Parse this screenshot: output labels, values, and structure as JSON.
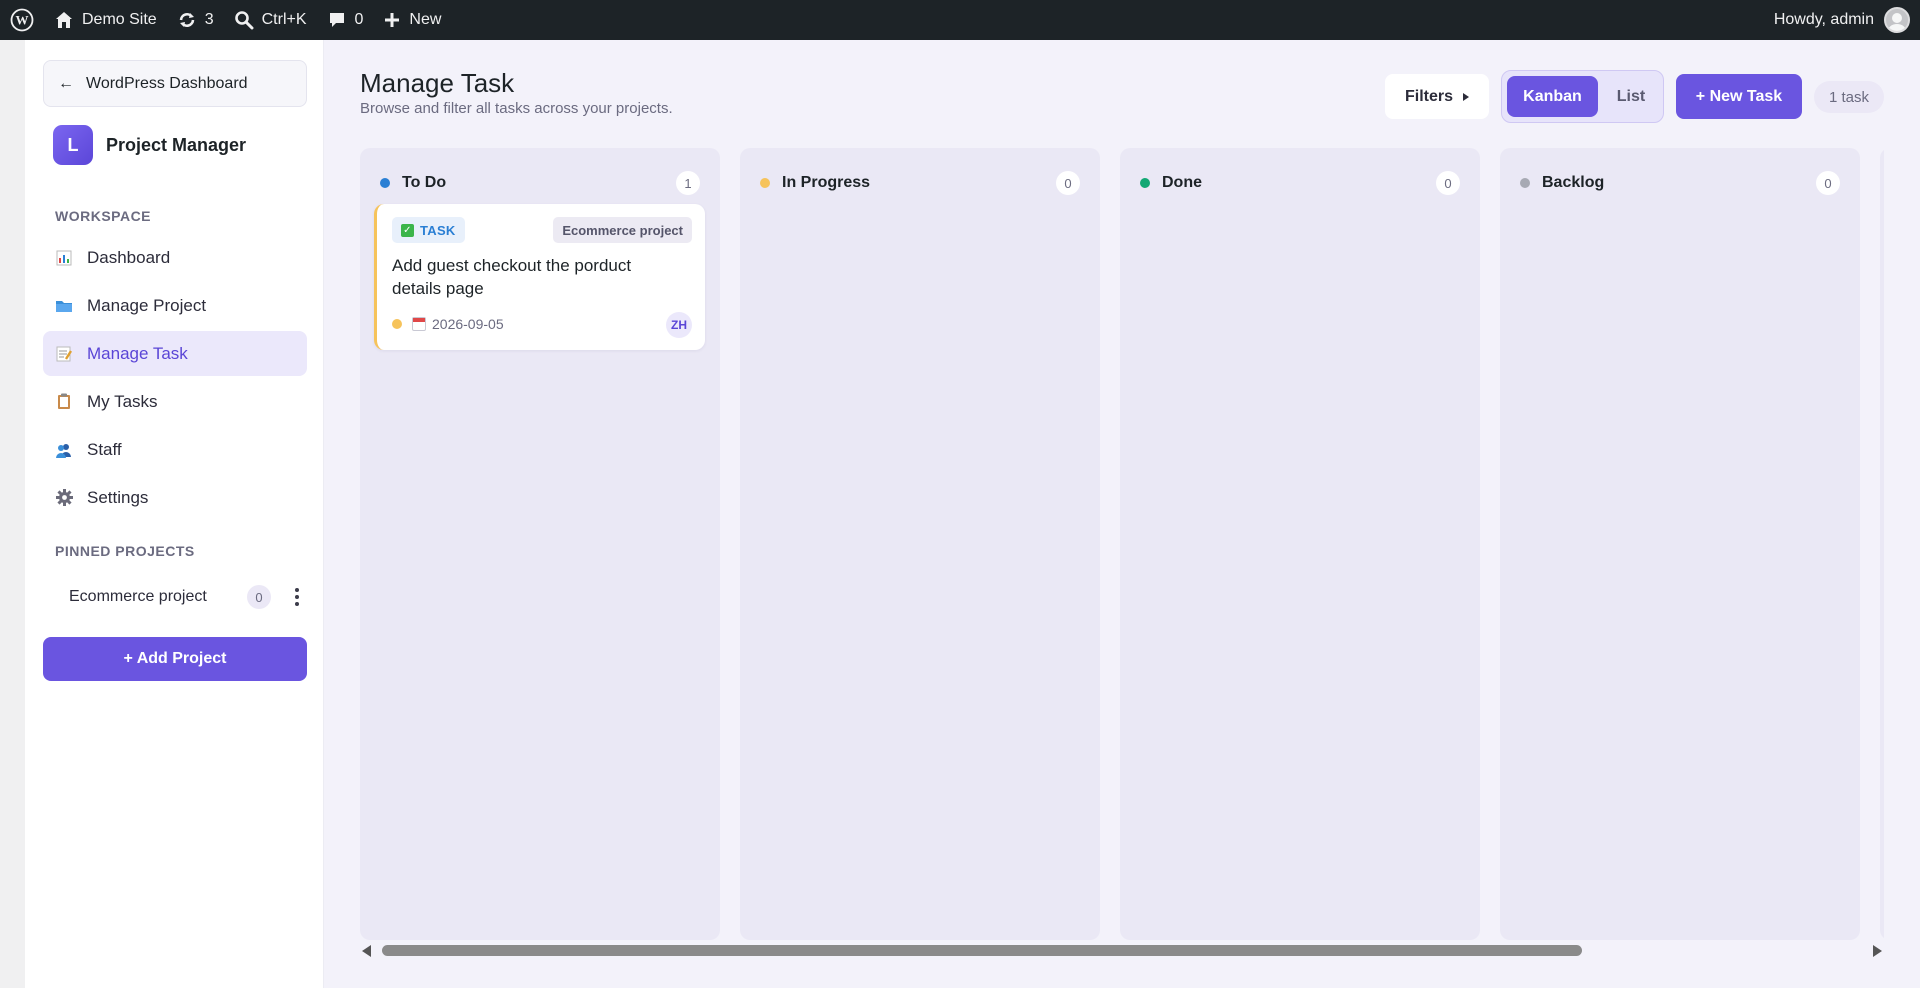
{
  "adminbar": {
    "site_name": "Demo Site",
    "updates_count": "3",
    "search_shortcut": "Ctrl+K",
    "comments_count": "0",
    "new_label": "New",
    "greeting": "Howdy, admin"
  },
  "sidebar": {
    "back_label": "WordPress Dashboard",
    "brand_logo_letter": "L",
    "brand_name": "Project Manager",
    "workspace_label": "WORKSPACE",
    "nav_items": [
      {
        "label": "Dashboard",
        "icon": "bar-chart-icon"
      },
      {
        "label": "Manage Project",
        "icon": "folder-icon"
      },
      {
        "label": "Manage Task",
        "icon": "memo-icon",
        "active": true
      },
      {
        "label": "My Tasks",
        "icon": "clipboard-icon"
      },
      {
        "label": "Staff",
        "icon": "people-icon"
      },
      {
        "label": "Settings",
        "icon": "gear-icon"
      }
    ],
    "pinned_label": "PINNED PROJECTS",
    "pinned_projects": [
      {
        "name": "Ecommerce project",
        "count": "0"
      }
    ],
    "add_project_label": "+ Add Project"
  },
  "main": {
    "title": "Manage Task",
    "subtitle": "Browse and filter all tasks across your projects.",
    "filters_label": "Filters",
    "view_toggle": {
      "kanban": "Kanban",
      "list": "List",
      "selected": "Kanban"
    },
    "new_task_label": "+ New Task",
    "task_count": "1 task"
  },
  "columns": [
    {
      "name": "To Do",
      "count": "1",
      "color": "#2a7fd4"
    },
    {
      "name": "In Progress",
      "count": "0",
      "color": "#f6c35b"
    },
    {
      "name": "Done",
      "count": "0",
      "color": "#13a874"
    },
    {
      "name": "Backlog",
      "count": "0",
      "color": "#a7a9b3"
    }
  ],
  "cards": [
    {
      "column": "To Do",
      "type": "TASK",
      "project": "Ecommerce project",
      "title": "Add guest checkout the porduct details page",
      "due_date": "2026-09-05",
      "assignee_initials": "ZH",
      "priority_color": "#f6c35b"
    }
  ],
  "colors": {
    "accent": "#6a55e0",
    "adminbar_bg": "#1d2327"
  }
}
